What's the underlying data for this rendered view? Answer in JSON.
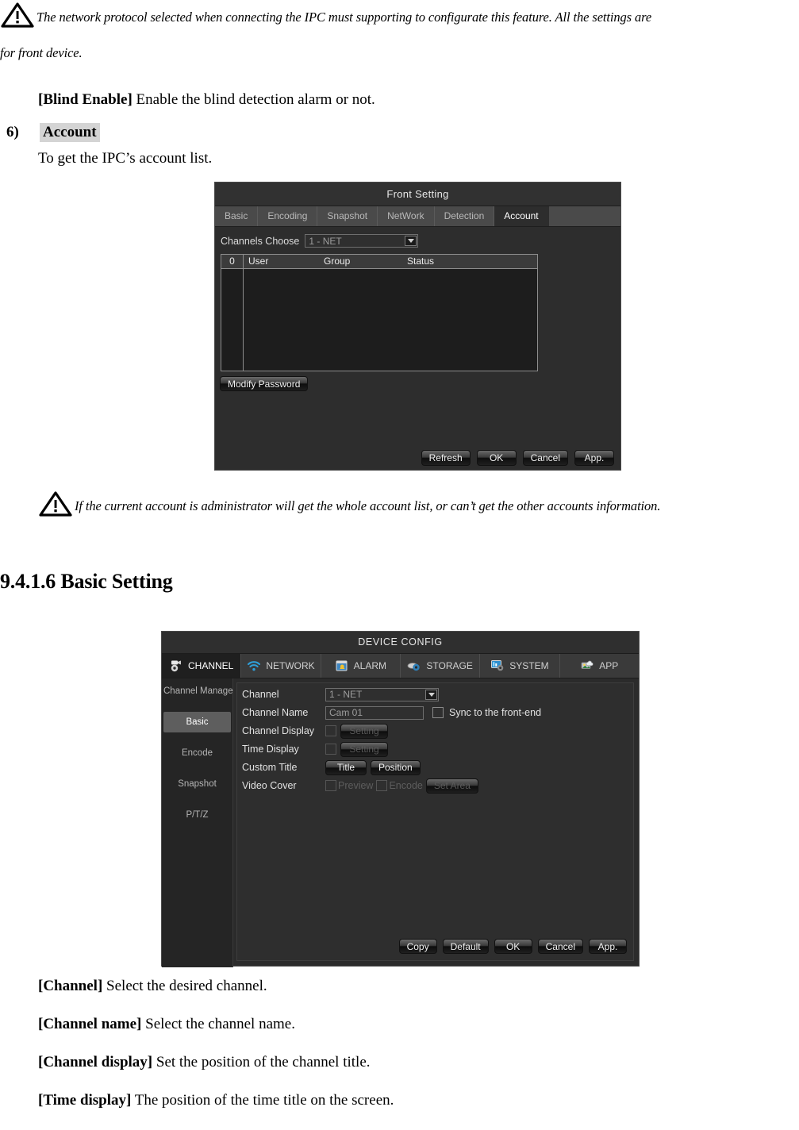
{
  "document": {
    "note_1_line_1": "The network protocol selected when connecting the IPC must supporting to configurate this feature. All the settings are",
    "note_1_line_2": "for front device.",
    "blind_enable_bold": "[Blind Enable]",
    "blind_enable_text": " Enable the blind detection alarm or not.",
    "list_number": "6)",
    "list_title": "Account",
    "list_subtext": "To get the IPC’s account list.",
    "note_2": "If the current account is administrator will get the whole account list, or can’t get the other accounts information.",
    "section_heading": "9.4.1.6 Basic Setting",
    "definitions": [
      {
        "term": "[Channel]",
        "desc": " Select the desired channel."
      },
      {
        "term": "[Channel name]",
        "desc": " Select the channel name."
      },
      {
        "term": "[Channel display]",
        "desc": " Set the position of the channel title."
      },
      {
        "term": "[Time display]",
        "desc": " The position of the time title on the screen."
      }
    ]
  },
  "front_setting": {
    "title": "Front Setting",
    "tabs": [
      {
        "label": "Basic",
        "active": false
      },
      {
        "label": "Encoding",
        "active": false
      },
      {
        "label": "Snapshot",
        "active": false
      },
      {
        "label": "NetWork",
        "active": false
      },
      {
        "label": "Detection",
        "active": false
      },
      {
        "label": "Account",
        "active": true
      }
    ],
    "channels_choose_label": "Channels Choose",
    "channels_choose_value": "1 - NET",
    "table": {
      "headers": [
        "0",
        "User",
        "Group",
        "Status"
      ],
      "rows": []
    },
    "modify_password_label": "Modify Password",
    "buttons": [
      "Refresh",
      "OK",
      "Cancel",
      "App."
    ]
  },
  "device_config": {
    "title": "DEVICE CONFIG",
    "tabs": [
      {
        "label": "CHANNEL",
        "icon": "camera-gear-icon",
        "active": true
      },
      {
        "label": "NETWORK",
        "icon": "wifi-icon",
        "active": false
      },
      {
        "label": "ALARM",
        "icon": "alarm-bell-icon",
        "active": false
      },
      {
        "label": "STORAGE",
        "icon": "disk-gear-icon",
        "active": false
      },
      {
        "label": "SYSTEM",
        "icon": "monitor-gear-icon",
        "active": false
      },
      {
        "label": "APP",
        "icon": "cloud-app-icon",
        "active": false
      }
    ],
    "sidebar": [
      {
        "label": "Channel Manage",
        "active": false
      },
      {
        "label": "Basic",
        "active": true
      },
      {
        "label": "Encode",
        "active": false
      },
      {
        "label": "Snapshot",
        "active": false
      },
      {
        "label": "P/T/Z",
        "active": false
      }
    ],
    "fields": {
      "channel_label": "Channel",
      "channel_value": "1 - NET",
      "channel_name_label": "Channel Name",
      "channel_name_value": "Cam 01",
      "sync_label": "Sync to the front-end",
      "channel_display_label": "Channel Display",
      "channel_display_btn": "Setting",
      "time_display_label": "Time Display",
      "time_display_btn": "Setting",
      "custom_title_label": "Custom Title",
      "custom_title_btn": "Title",
      "custom_position_btn": "Position",
      "video_cover_label": "Video Cover",
      "video_cover_preview": "Preview",
      "video_cover_encode": "Encode",
      "video_cover_btn": "Set Area"
    },
    "buttons": [
      "Copy",
      "Default",
      "OK",
      "Cancel",
      "App."
    ]
  },
  "colors": {
    "dialog_bg": "#2b2b2b",
    "accent_blue": "#2e9fd8",
    "active_tab_bg": "#1f1f1f",
    "sidebar_active": "#5e5e5e",
    "highlight_grey": "#d4d4d4"
  }
}
